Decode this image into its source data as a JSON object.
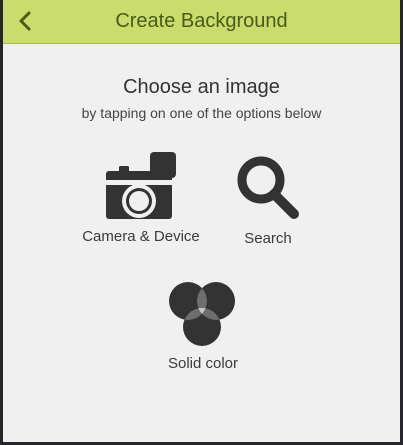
{
  "header": {
    "title": "Create Background",
    "back_icon": "chevron-left-icon",
    "background_color": "#c9dc6c",
    "title_color": "#4b5a1b"
  },
  "main": {
    "heading": "Choose an image",
    "subheading": "by tapping on one of the options below",
    "options": [
      {
        "label": "Camera & Device",
        "icon": "camera-icon"
      },
      {
        "label": "Search",
        "icon": "search-icon"
      },
      {
        "label": "Solid color",
        "icon": "color-circles-icon"
      }
    ]
  }
}
